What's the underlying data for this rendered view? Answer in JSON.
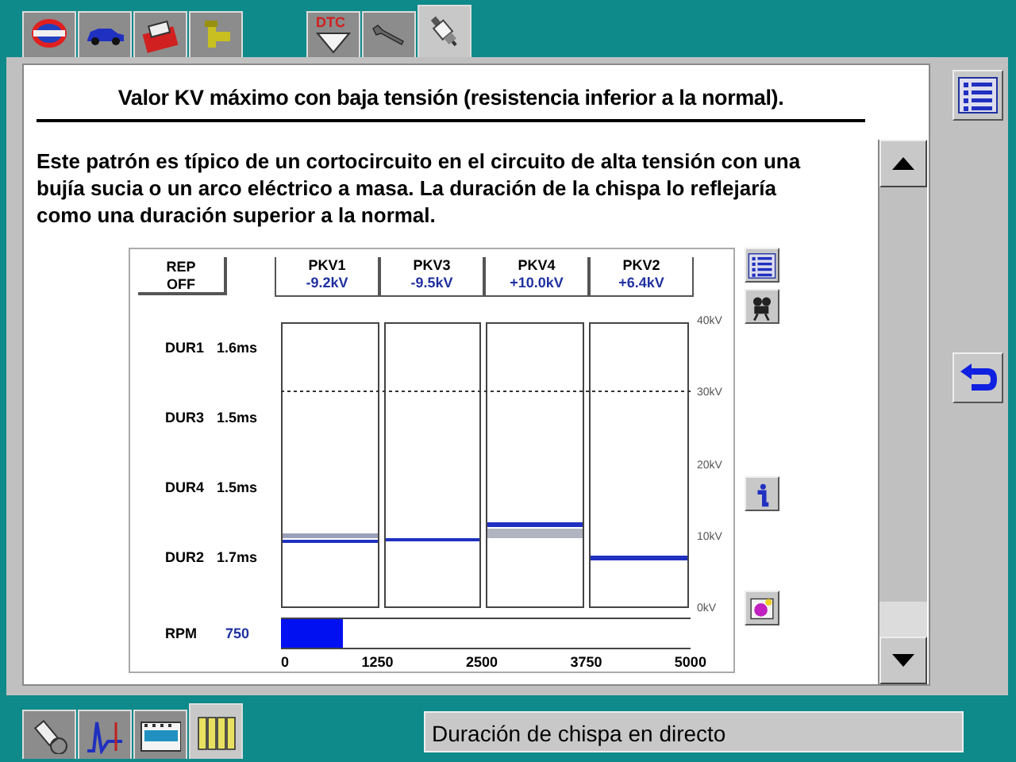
{
  "top_tabs_left": [
    {
      "kind": "logo",
      "selected": false
    },
    {
      "kind": "car",
      "selected": false
    },
    {
      "kind": "toolbox",
      "selected": false
    },
    {
      "kind": "connector",
      "selected": false
    }
  ],
  "top_tabs_right": [
    {
      "kind": "dtc",
      "label": "DTC",
      "selected": false
    },
    {
      "kind": "wrench",
      "selected": false
    },
    {
      "kind": "spark-plug",
      "selected": true
    }
  ],
  "title": "Valor KV máximo con baja tensión (resistencia inferior a la normal).",
  "description": "Este patrón es típico de un cortocircuito en el circuito de alta tensión con una bujía sucia o un arco eléctrico a masa. La duración de la chispa lo reflejaría como una duración superior a la normal.",
  "scope": {
    "rep_button": "REP OFF",
    "cylinders": [
      {
        "label": "PKV1",
        "value": "-9.2kV"
      },
      {
        "label": "PKV3",
        "value": "-9.5kV"
      },
      {
        "label": "PKV4",
        "value": "+10.0kV"
      },
      {
        "label": "PKV2",
        "value": "+6.4kV"
      }
    ],
    "durations": [
      {
        "label": "DUR1",
        "value": "1.6ms"
      },
      {
        "label": "DUR3",
        "value": "1.5ms"
      },
      {
        "label": "DUR4",
        "value": "1.5ms"
      },
      {
        "label": "DUR2",
        "value": "1.7ms"
      }
    ],
    "scale": [
      "40kV",
      "30kV",
      "20kV",
      "10kV",
      "0kV"
    ],
    "rpm": {
      "label": "RPM",
      "value": "750",
      "level": 0.15,
      "ticks": [
        "0",
        "1250",
        "2500",
        "3750",
        "5000"
      ]
    },
    "side_tools": [
      {
        "kind": "list"
      },
      {
        "kind": "camera"
      },
      {
        "kind": "info"
      },
      {
        "kind": "paint"
      }
    ]
  },
  "right_tools": [
    {
      "kind": "list"
    },
    {
      "kind": "back"
    }
  ],
  "bottom_tabs": [
    {
      "kind": "sensor",
      "selected": false
    },
    {
      "kind": "waveform",
      "selected": false
    },
    {
      "kind": "film",
      "selected": false
    },
    {
      "kind": "books",
      "selected": true
    }
  ],
  "status": "Duración de chispa en directo"
}
